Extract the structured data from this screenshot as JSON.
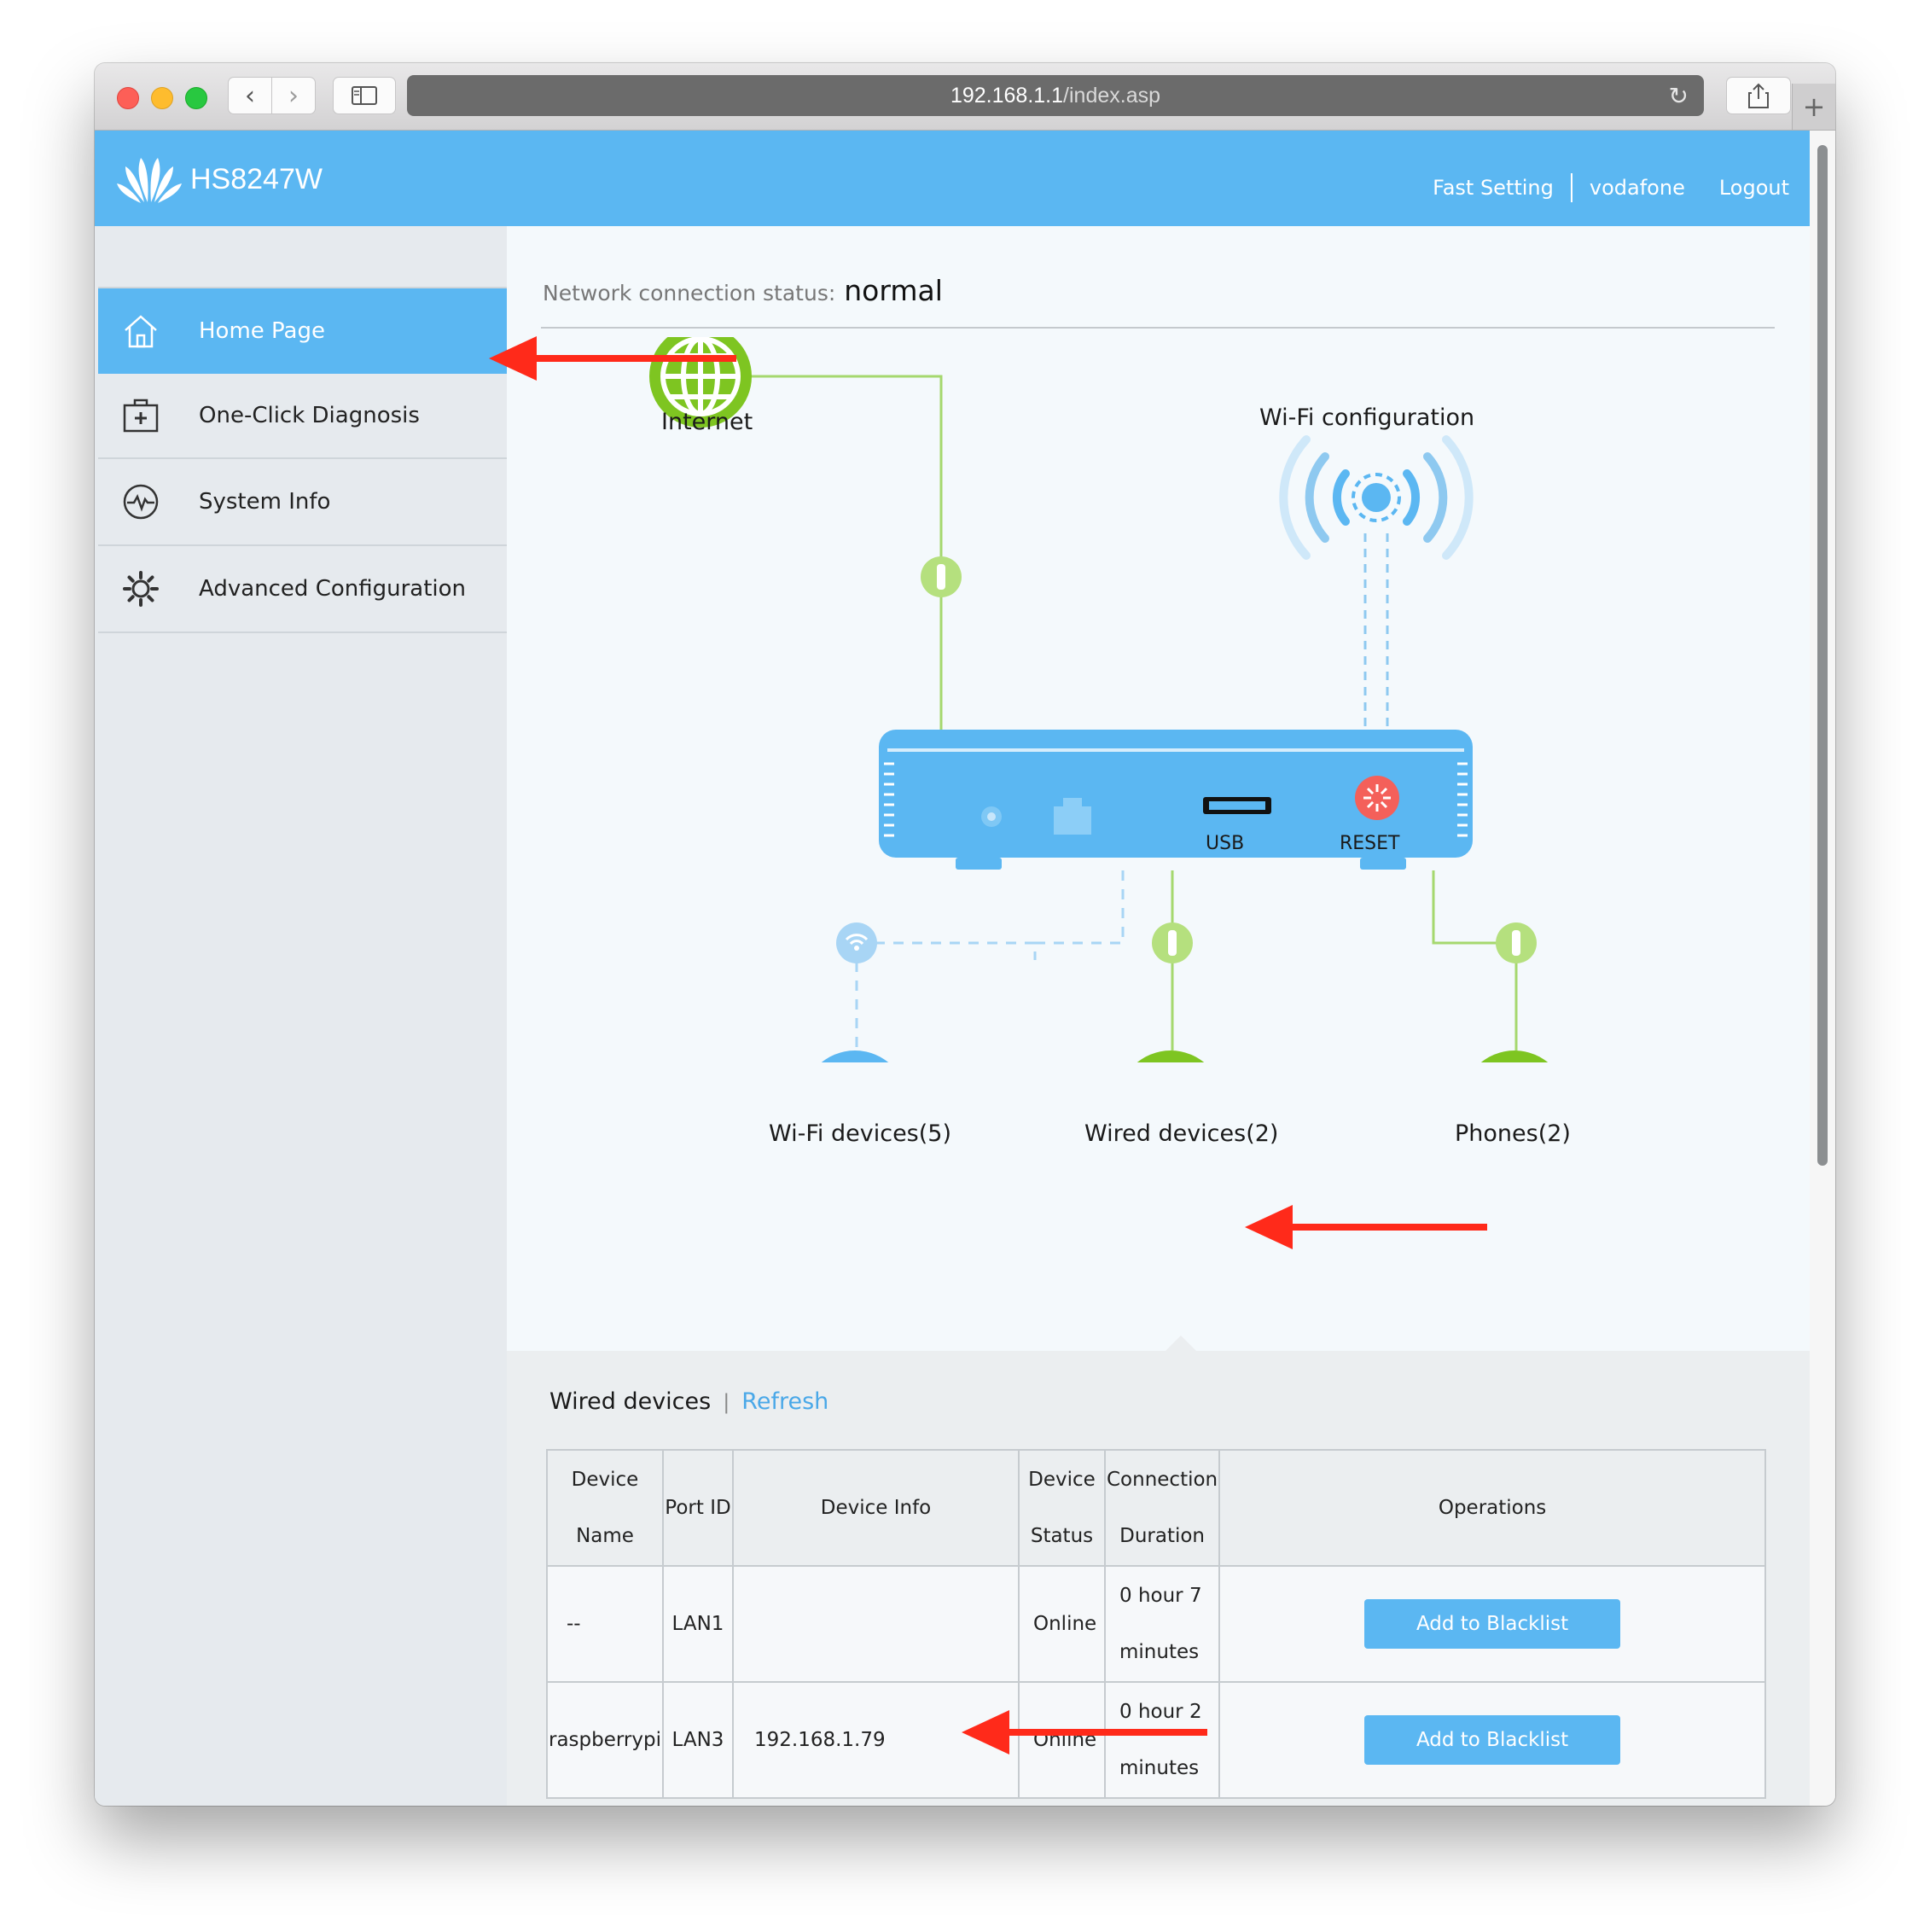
{
  "browser": {
    "url_host": "192.168.1.1",
    "url_path": "/index.asp"
  },
  "header": {
    "brand": "HS8247W",
    "links": {
      "fast_setting": "Fast Setting",
      "user": "vodafone",
      "logout": "Logout"
    }
  },
  "sidebar": {
    "items": [
      {
        "label": "Home Page",
        "icon": "home-icon",
        "active": true
      },
      {
        "label": "One-Click Diagnosis",
        "icon": "diagnosis-kit-icon",
        "active": false
      },
      {
        "label": "System Info",
        "icon": "pulse-icon",
        "active": false
      },
      {
        "label": "Advanced Configuration",
        "icon": "gear-icon",
        "active": false
      }
    ]
  },
  "status": {
    "label": "Network connection status:",
    "value": "normal"
  },
  "topology": {
    "internet": "Internet",
    "wifi_config": "Wi-Fi configuration",
    "usb": "USB",
    "reset": "RESET",
    "wifi_devices": "Wi-Fi devices(5)",
    "wired_devices": "Wired devices(2)",
    "phones": "Phones(2)"
  },
  "wired_panel": {
    "title": "Wired devices",
    "separator": "|",
    "refresh": "Refresh",
    "columns": [
      "Device Name",
      "Port ID",
      "Device Info",
      "Device\nStatus",
      "Connection\nDuration",
      "Operations"
    ],
    "rows": [
      {
        "name": "--",
        "port": "LAN1",
        "info": "",
        "status": "Online",
        "duration_1": "0 hour 7",
        "duration_2": "minutes",
        "action": "Add to Blacklist"
      },
      {
        "name": "raspberrypi",
        "port": "LAN3",
        "info": "192.168.1.79",
        "status": "Online",
        "duration_1": "0 hour 2",
        "duration_2": "minutes",
        "action": "Add to Blacklist"
      }
    ]
  },
  "colors": {
    "accent": "#5bb7f2",
    "green": "#7ec521",
    "annotation_arrow": "#ff2a1a"
  }
}
